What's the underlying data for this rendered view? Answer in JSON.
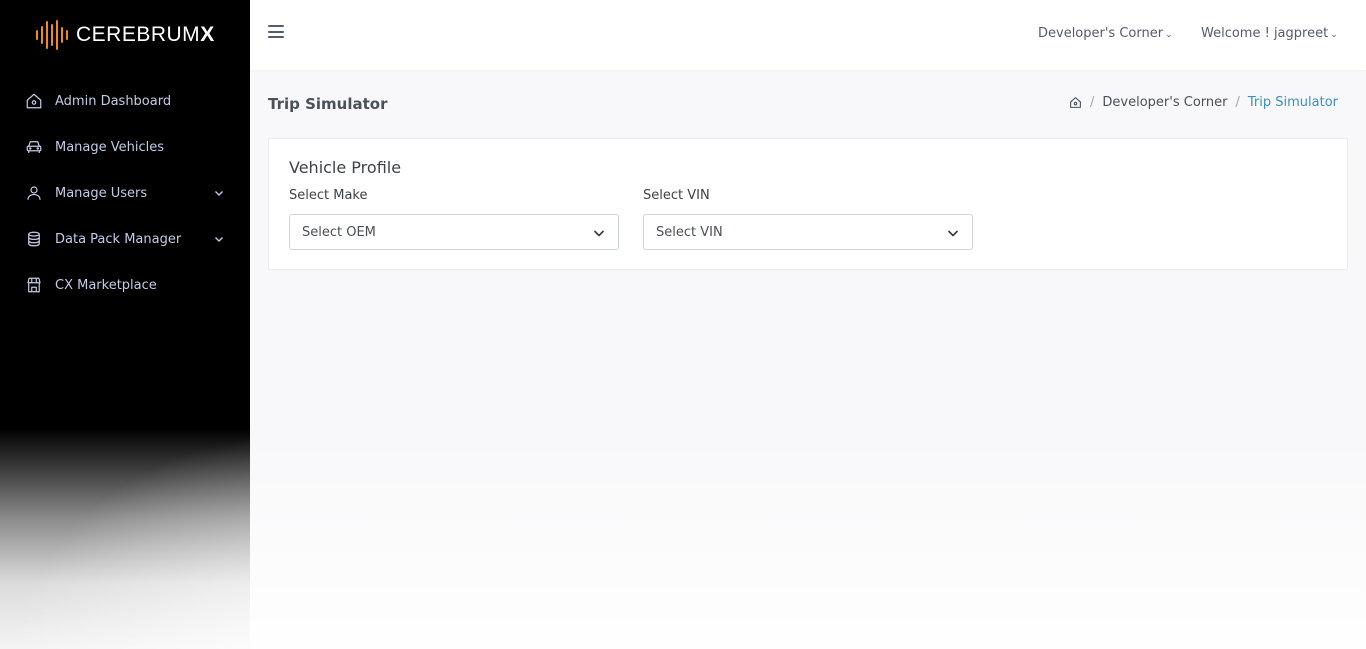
{
  "brand": {
    "name_light": "CEREBRUM",
    "name_bold": "X",
    "accent": "#f08a24"
  },
  "sidebar": {
    "items": [
      {
        "label": "Admin Dashboard",
        "icon": "home-icon",
        "has_submenu": false
      },
      {
        "label": "Manage Vehicles",
        "icon": "car-icon",
        "has_submenu": false
      },
      {
        "label": "Manage Users",
        "icon": "user-icon",
        "has_submenu": true
      },
      {
        "label": "Data Pack Manager",
        "icon": "database-icon",
        "has_submenu": true
      },
      {
        "label": "CX Marketplace",
        "icon": "store-icon",
        "has_submenu": false
      }
    ]
  },
  "topbar": {
    "developer_menu": "Developer's Corner",
    "user_menu": "Welcome ! jagpreet"
  },
  "page": {
    "title": "Trip Simulator",
    "breadcrumb": [
      "Developer's Corner",
      "Trip Simulator"
    ]
  },
  "card": {
    "title": "Vehicle Profile",
    "make_label": "Select Make",
    "make_value": "Select OEM",
    "vin_label": "Select VIN",
    "vin_value": "Select VIN"
  }
}
